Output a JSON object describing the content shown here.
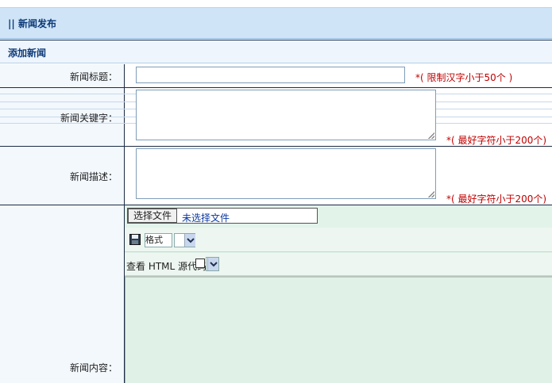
{
  "header": {
    "title": "|| 新闻发布"
  },
  "section": {
    "title": "添加新闻"
  },
  "fields": {
    "title": {
      "label": "新闻标题：",
      "value": "",
      "hint": "*( 限制汉字小于50个 )"
    },
    "keywords": {
      "label": "新闻关键字：",
      "value": "",
      "hint": "*( 最好字符小于200个)"
    },
    "description": {
      "label": "新闻描述：",
      "value": "",
      "hint": "*( 最好字符小于200个)"
    },
    "content": {
      "label": "新闻内容："
    }
  },
  "upload": {
    "button": "选择文件",
    "status": "未选择文件"
  },
  "toolbar": {
    "format_label": "格式",
    "html_label": "查看 HTML 源代码"
  },
  "colors": {
    "header_bg": "#cfe4f7",
    "title_color": "#0d3a78",
    "hint_color": "#c00000",
    "editor_bg": "#e0f1e7"
  }
}
